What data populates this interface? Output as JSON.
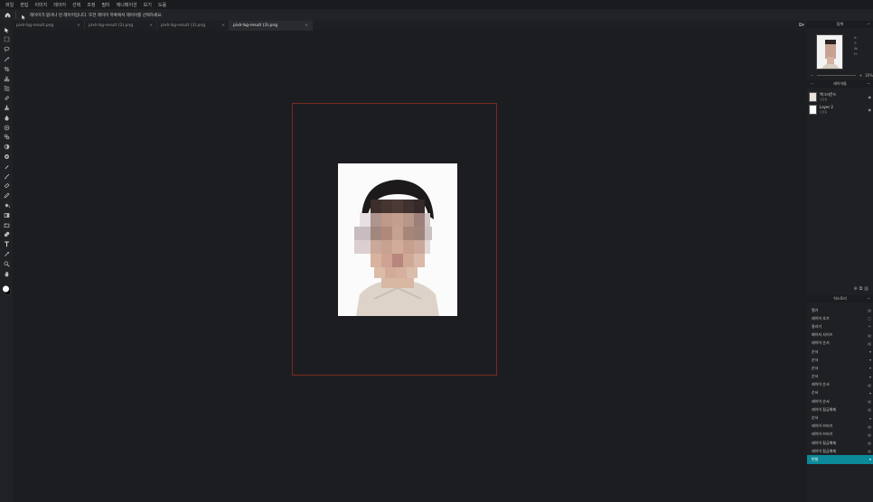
{
  "menu": [
    "파일",
    "편집",
    "이미지",
    "레이어",
    "선택",
    "조정",
    "필터",
    "애니메이션",
    "보기",
    "도움"
  ],
  "options_hint": "레이어가 없거나 된 레이어입니다. 또한 레이어 목록에서 레이어를 선택하세요.",
  "tabs": [
    {
      "label": "pixlr-bg-result.png",
      "close": "×"
    },
    {
      "label": "pixlr-bg-result (2).png",
      "close": "×"
    },
    {
      "label": "pixlr-bg-result (3).png",
      "close": "×"
    },
    {
      "label": "pixlr-bg-result (3).png",
      "close": "×"
    }
  ],
  "navigator": {
    "title": "탐색",
    "info": [
      "X:",
      "Y:",
      "W:",
      "H:"
    ],
    "zoom_minus": "−",
    "zoom_plus": "+",
    "zoom_value": "30%"
  },
  "layers_panel": {
    "title": "레이어들",
    "layers": [
      {
        "name": "백그라운드",
        "sub": "잠금됨"
      },
      {
        "name": "Layer 2",
        "sub": "잠금됨"
      }
    ]
  },
  "history_panel": {
    "title": "히스토리",
    "items": [
      "열기",
      "레이어 추가",
      "잘라기",
      "페이지 사이즈",
      "레이어 순서",
      "순서",
      "순서",
      "순서",
      "순서",
      "레이어 순서",
      "순서",
      "레이어 순서",
      "레이어 잠금해제",
      "순서",
      "레이어 브러기",
      "레이어 브러기",
      "레이어 잠금해제",
      "레이어 잠금해제",
      "변형"
    ],
    "active_index": 18
  },
  "colors": {
    "accent": "#0c8a9a",
    "artboard_border": "#7a2a22",
    "canvas": "#1c1d20"
  }
}
